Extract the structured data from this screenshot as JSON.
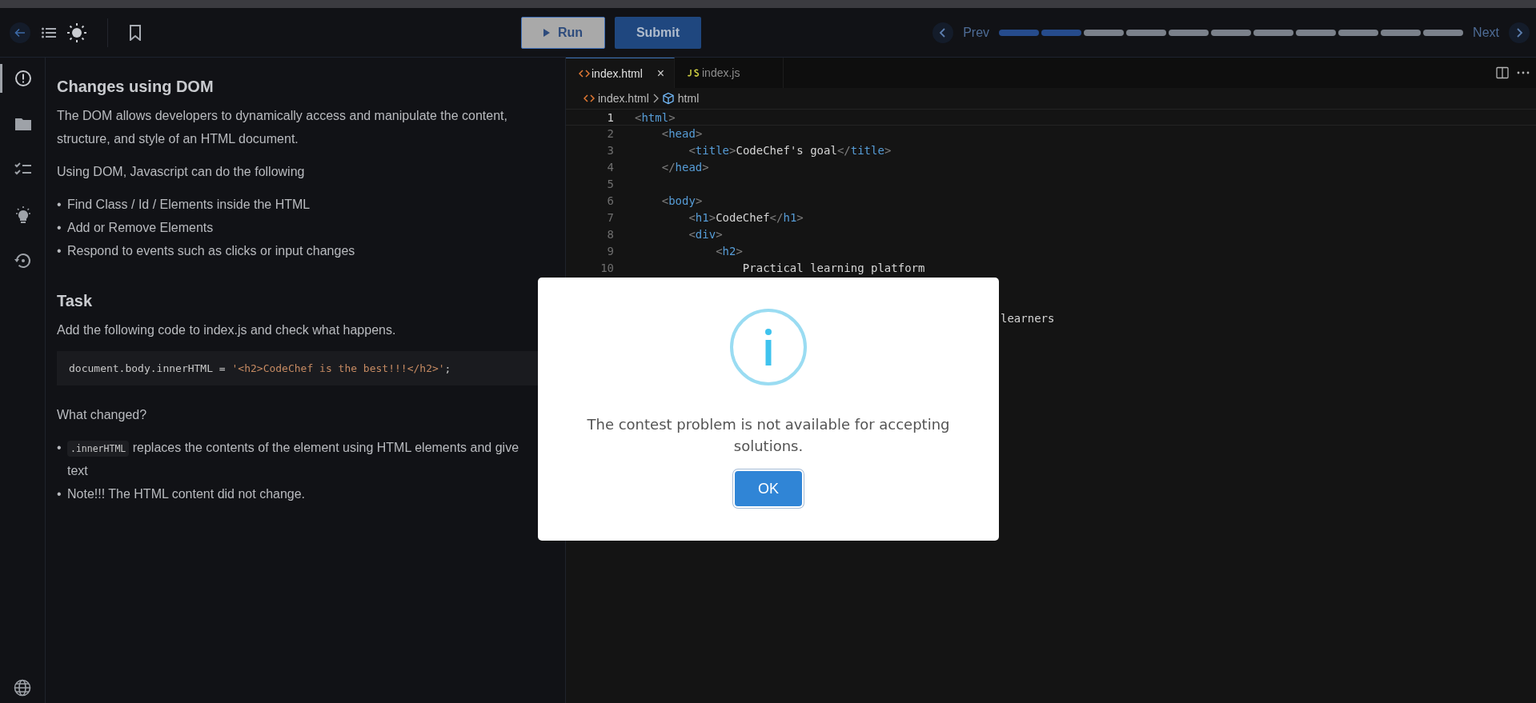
{
  "toolbar": {
    "run_label": "Run",
    "submit_label": "Submit",
    "prev_label": "Prev",
    "next_label": "Next",
    "steps": [
      {
        "done": true
      },
      {
        "done": true
      },
      {
        "done": false
      },
      {
        "done": false
      },
      {
        "done": false
      },
      {
        "done": false
      },
      {
        "done": false
      },
      {
        "done": false
      },
      {
        "done": false
      },
      {
        "done": false
      },
      {
        "done": false
      }
    ]
  },
  "rail": {
    "items": [
      {
        "selected": true
      },
      {
        "selected": false
      },
      {
        "selected": false
      },
      {
        "selected": false
      },
      {
        "selected": false
      }
    ]
  },
  "problem": {
    "title": "Changes using DOM",
    "intro": "The DOM allows developers to dynamically access and manipulate the content, structure, and style of an HTML document.",
    "lead": "Using DOM, Javascript can do the following",
    "marker": "•",
    "bullets": [
      "Find Class / Id / Elements inside the HTML",
      "Add or Remove Elements",
      "Respond to events such as clicks or input changes"
    ],
    "task_title": "Task",
    "task_text": "Add the following code to index.js and check what happens.",
    "code": {
      "plain": "document.body.innerHTML = ",
      "string": "'<h2>CodeChef is the best!!!</h2>'",
      "end": ";"
    },
    "question": "What changed?",
    "notes": [
      {
        "code": ".innerHTML",
        "text": "replaces the contents of the element using HTML elements and give",
        "continuation": "text"
      },
      {
        "text": "Note!!! The HTML content did not change."
      }
    ]
  },
  "editor": {
    "tabs": [
      {
        "label": "index.html",
        "kind": "html",
        "selected": true,
        "close": "×"
      },
      {
        "label": "index.js",
        "kind": "js",
        "selected": false
      }
    ],
    "breadcrumb": [
      "index.html",
      "html"
    ],
    "lines": [
      {
        "number": "1",
        "current": true,
        "tokens": [
          {
            "kind": "punct",
            "text": "<"
          },
          {
            "kind": "tag",
            "text": "html"
          },
          {
            "kind": "punct",
            "text": ">"
          }
        ]
      },
      {
        "number": "2",
        "current": false,
        "tokens": [
          {
            "kind": "punct",
            "text": "    <"
          },
          {
            "kind": "tag",
            "text": "head"
          },
          {
            "kind": "punct",
            "text": ">"
          }
        ]
      },
      {
        "number": "3",
        "current": false,
        "tokens": [
          {
            "kind": "punct",
            "text": "        <"
          },
          {
            "kind": "tag",
            "text": "title"
          },
          {
            "kind": "punct",
            "text": ">"
          },
          {
            "kind": "plain",
            "text": "CodeChef's goal"
          },
          {
            "kind": "punct",
            "text": "</"
          },
          {
            "kind": "tag",
            "text": "title"
          },
          {
            "kind": "punct",
            "text": ">"
          }
        ]
      },
      {
        "number": "4",
        "current": false,
        "tokens": [
          {
            "kind": "punct",
            "text": "    </"
          },
          {
            "kind": "tag",
            "text": "head"
          },
          {
            "kind": "punct",
            "text": ">"
          }
        ]
      },
      {
        "number": "5",
        "current": false
      },
      {
        "number": "6",
        "current": false,
        "tokens": [
          {
            "kind": "punct",
            "text": "    <"
          },
          {
            "kind": "tag",
            "text": "body"
          },
          {
            "kind": "punct",
            "text": ">"
          }
        ]
      },
      {
        "number": "7",
        "current": false,
        "tokens": [
          {
            "kind": "punct",
            "text": "        <"
          },
          {
            "kind": "tag",
            "text": "h1"
          },
          {
            "kind": "punct",
            "text": ">"
          },
          {
            "kind": "plain",
            "text": "CodeChef"
          },
          {
            "kind": "punct",
            "text": "</"
          },
          {
            "kind": "tag",
            "text": "h1"
          },
          {
            "kind": "punct",
            "text": ">"
          }
        ]
      },
      {
        "number": "8",
        "current": false,
        "tokens": [
          {
            "kind": "punct",
            "text": "        <"
          },
          {
            "kind": "tag",
            "text": "div"
          },
          {
            "kind": "punct",
            "text": ">"
          }
        ]
      },
      {
        "number": "9",
        "current": false,
        "tokens": [
          {
            "kind": "punct",
            "text": "            <"
          },
          {
            "kind": "tag",
            "text": "h2"
          },
          {
            "kind": "punct",
            "text": ">"
          }
        ]
      },
      {
        "number": "10",
        "current": false,
        "tokens": [
          {
            "kind": "plain",
            "text": "                Practical learning platform"
          }
        ]
      }
    ],
    "tail_text": "learners"
  },
  "dialog": {
    "message": "The contest problem is not available for accepting solutions.",
    "button": "OK"
  }
}
